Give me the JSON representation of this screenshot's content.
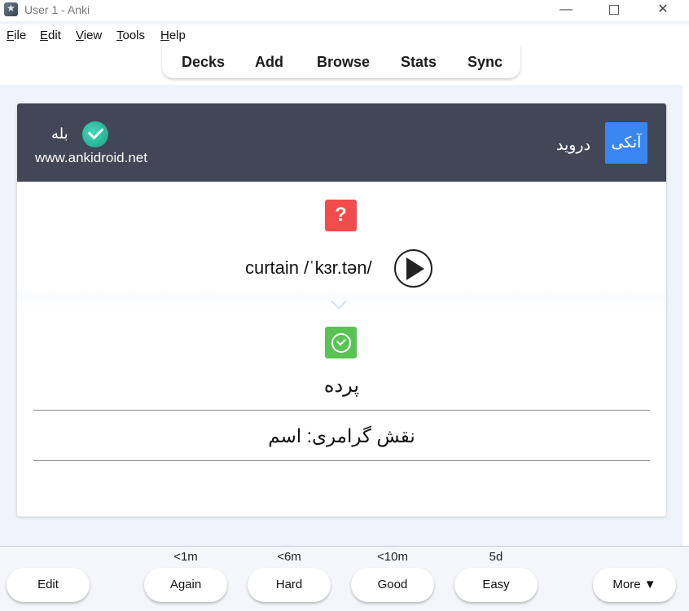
{
  "window": {
    "title": "User 1 - Anki",
    "minimize": "—",
    "close": "✕"
  },
  "menu": [
    {
      "u": "F",
      "rest": "ile"
    },
    {
      "u": "E",
      "rest": "dit"
    },
    {
      "u": "V",
      "rest": "iew"
    },
    {
      "u": "T",
      "rest": "ools"
    },
    {
      "u": "H",
      "rest": "elp"
    }
  ],
  "toolbar": {
    "decks": "Decks",
    "add": "Add",
    "browse": "Browse",
    "stats": "Stats",
    "sync": "Sync"
  },
  "card": {
    "brand_yes": "بله",
    "brand_url": "www.ankidroid.net",
    "ankidroid_word": "درويد",
    "anki_badge": "آنکی",
    "question_mark": "?",
    "word": "curtain /ˈkɜr.tən/",
    "answer": "پرده",
    "grammar": "نقش گرامری: اسم"
  },
  "answer_bar": {
    "edit": "Edit",
    "again": {
      "label": "Again",
      "interval": "<1m"
    },
    "hard": {
      "label": "Hard",
      "interval": "<6m"
    },
    "good": {
      "label": "Good",
      "interval": "<10m"
    },
    "easy": {
      "label": "Easy",
      "interval": "5d"
    },
    "more": "More ▼"
  }
}
